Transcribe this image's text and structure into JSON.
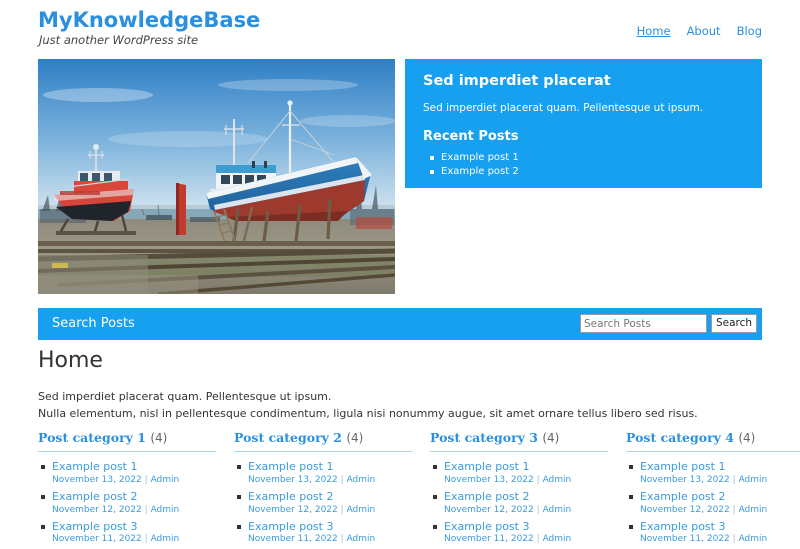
{
  "header": {
    "site_title": "MyKnowledgeBase",
    "tagline": "Just another WordPress site",
    "nav": [
      {
        "label": "Home",
        "active": true
      },
      {
        "label": "About",
        "active": false
      },
      {
        "label": "Blog",
        "active": false
      }
    ]
  },
  "hero": {
    "image_alt": "boats-in-drydock-photo",
    "promo": {
      "title": "Sed imperdiet placerat",
      "text": "Sed imperdiet placerat quam. Pellentesque ut ipsum.",
      "recent_posts_heading": "Recent Posts",
      "recent_posts": [
        "Example post 1",
        "Example post 2"
      ]
    }
  },
  "search": {
    "bar_label": "Search Posts",
    "input_value": "",
    "input_placeholder": "Search Posts",
    "button_label": "Search"
  },
  "main": {
    "page_title": "Home",
    "intro_lines": [
      "Sed imperdiet placerat quam. Pellentesque ut ipsum.",
      "Nulla elementum, nisl in pellentesque condimentum, ligula nisi nonummy augue, sit amet ornare tellus libero sed risus."
    ]
  },
  "categories": [
    {
      "title": "Post category 1",
      "count": "(4)",
      "posts": [
        {
          "title": "Example post 1",
          "date": "November 13, 2022",
          "separator": "|",
          "author": "Admin"
        },
        {
          "title": "Example post 2",
          "date": "November 12, 2022",
          "separator": "|",
          "author": "Admin"
        },
        {
          "title": "Example post 3",
          "date": "November 11, 2022",
          "separator": "|",
          "author": "Admin"
        }
      ]
    },
    {
      "title": "Post category 2",
      "count": "(4)",
      "posts": [
        {
          "title": "Example post 1",
          "date": "November 13, 2022",
          "separator": "|",
          "author": "Admin"
        },
        {
          "title": "Example post 2",
          "date": "November 12, 2022",
          "separator": "|",
          "author": "Admin"
        },
        {
          "title": "Example post 3",
          "date": "November 11, 2022",
          "separator": "|",
          "author": "Admin"
        }
      ]
    },
    {
      "title": "Post category 3",
      "count": "(4)",
      "posts": [
        {
          "title": "Example post 1",
          "date": "November 13, 2022",
          "separator": "|",
          "author": "Admin"
        },
        {
          "title": "Example post 2",
          "date": "November 12, 2022",
          "separator": "|",
          "author": "Admin"
        },
        {
          "title": "Example post 3",
          "date": "November 11, 2022",
          "separator": "|",
          "author": "Admin"
        }
      ]
    },
    {
      "title": "Post category 4",
      "count": "(4)",
      "posts": [
        {
          "title": "Example post 1",
          "date": "November 13, 2022",
          "separator": "|",
          "author": "Admin"
        },
        {
          "title": "Example post 2",
          "date": "November 12, 2022",
          "separator": "|",
          "author": "Admin"
        },
        {
          "title": "Example post 3",
          "date": "November 11, 2022",
          "separator": "|",
          "author": "Admin"
        }
      ]
    }
  ],
  "colors": {
    "accent_blue": "#17a0ef",
    "link_blue": "#2b8fe0",
    "text": "#333333",
    "rule": "#a9d8f5"
  }
}
